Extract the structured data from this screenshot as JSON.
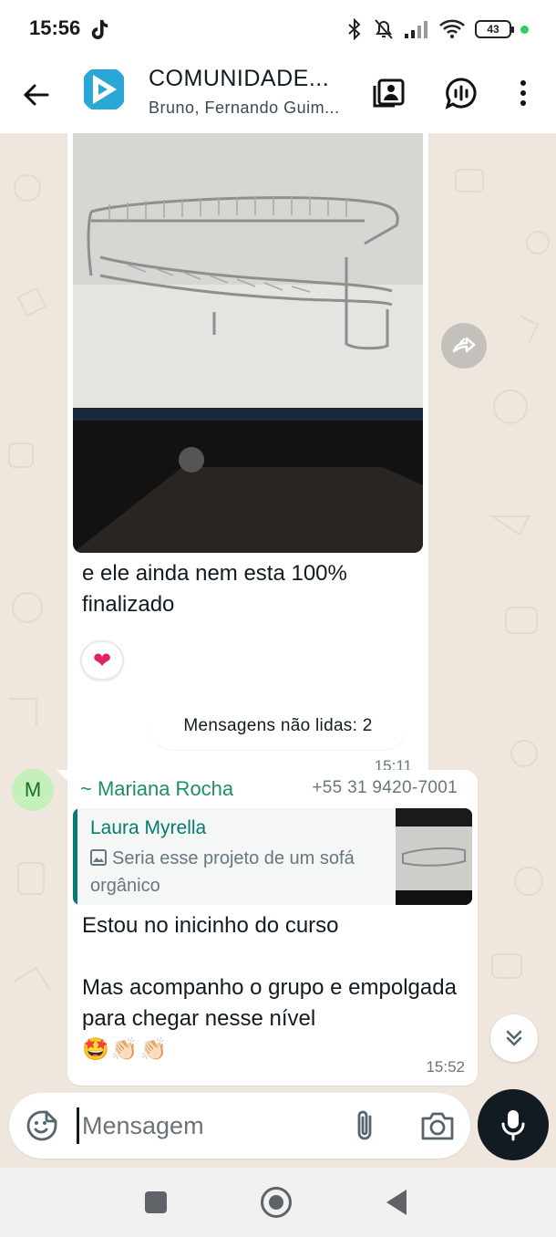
{
  "status_bar": {
    "time": "15:56",
    "battery": "43",
    "icons": [
      "tiktok-icon",
      "bluetooth-icon",
      "muted-bell-icon",
      "signal-icon",
      "wifi-icon",
      "battery-icon"
    ]
  },
  "header": {
    "title": "COMUNIDADE...",
    "subtitle": "Bruno, Fernando Guim...",
    "icons": [
      "back-arrow-icon",
      "group-avatar",
      "catalog-icon",
      "voice-chat-icon",
      "more-vert-icon"
    ]
  },
  "messages": [
    {
      "type": "image",
      "text": "e ele ainda nem esta 100% finalizado",
      "time": "15:11",
      "reaction": "❤"
    },
    {
      "type": "reply",
      "sender_name": "~ Mariana Rocha",
      "sender_phone": "+55 31 9420-7001",
      "avatar_letter": "M",
      "quote_author": "Laura Myrella",
      "quote_text": "Seria esse projeto de um sofá orgânico",
      "lines": [
        "Estou no inicinho do curso",
        "Mas acompanho o grupo e empolgada para chegar nesse nível"
      ],
      "emojis": "🤩👏🏻👏🏻",
      "time": "15:52"
    }
  ],
  "unread_divider": "Mensagens não lidas: 2",
  "composer": {
    "placeholder": "Mensagem"
  },
  "colors": {
    "accent_green": "#25d366",
    "quote_teal": "#067b6f",
    "sender_green": "#1f8f61",
    "chat_background": "#efe7de"
  }
}
